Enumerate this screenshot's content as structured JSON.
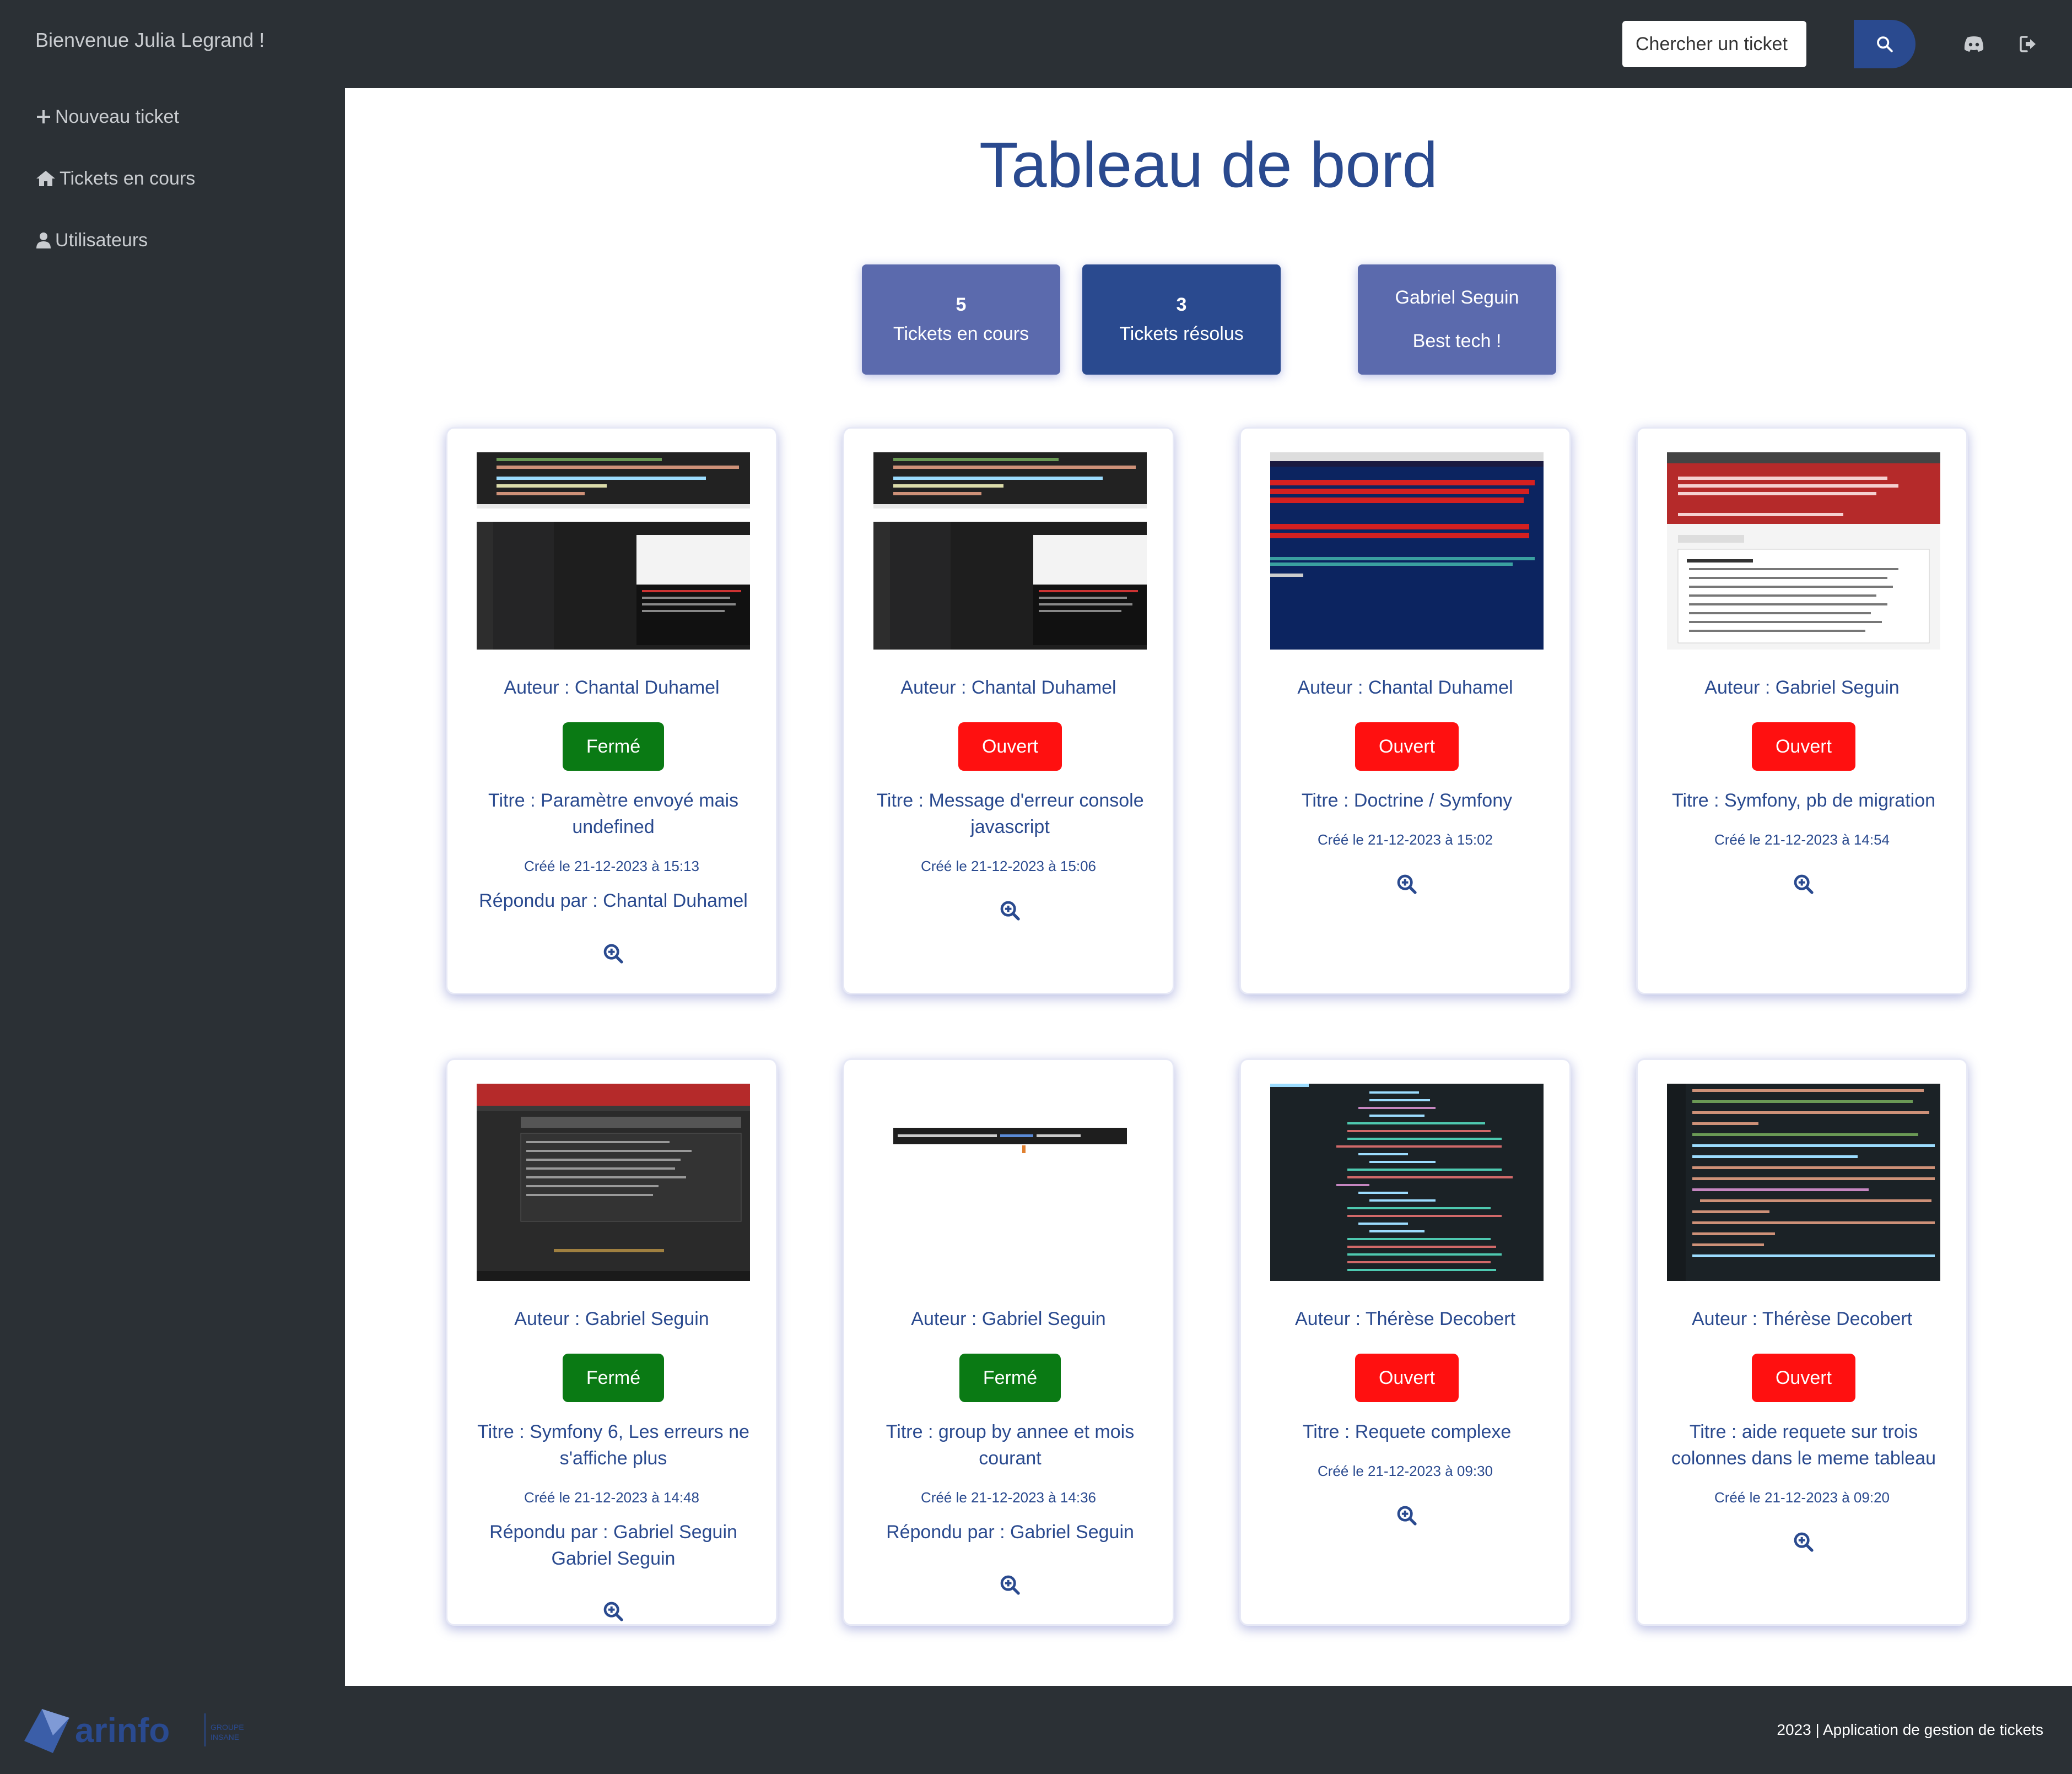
{
  "header": {
    "welcome": "Bienvenue Julia Legrand !",
    "search_placeholder": "Chercher un ticket"
  },
  "icons": {
    "search": "search-icon",
    "discord": "discord-icon",
    "logout": "logout-icon"
  },
  "sidebar": {
    "items": [
      {
        "label": "Nouveau ticket",
        "icon": "plus-icon"
      },
      {
        "label": "Tickets en cours",
        "icon": "home-icon"
      },
      {
        "label": "Utilisateurs",
        "icon": "user-icon"
      }
    ]
  },
  "main": {
    "title": "Tableau de bord",
    "stats": [
      {
        "value": "5",
        "label": "Tickets en cours"
      },
      {
        "value": "3",
        "label": "Tickets résolus"
      },
      {
        "value": "Gabriel Seguin",
        "label": "Best tech !"
      }
    ],
    "tickets": [
      {
        "author": "Auteur : Chantal Duhamel",
        "status": "Fermé",
        "title": "Titre : Paramètre envoyé mais undefined",
        "date": "Créé le 21-12-2023 à 15:13",
        "reply": "Répondu par : Chantal Duhamel"
      },
      {
        "author": "Auteur : Chantal Duhamel",
        "status": "Ouvert",
        "title": "Titre : Message d'erreur console javascript",
        "date": "Créé le 21-12-2023 à 15:06"
      },
      {
        "author": "Auteur : Chantal Duhamel",
        "status": "Ouvert",
        "title": "Titre : Doctrine / Symfony",
        "date": "Créé le 21-12-2023 à 15:02"
      },
      {
        "author": "Auteur : Gabriel Seguin",
        "status": "Ouvert",
        "title": "Titre : Symfony, pb de migration",
        "date": "Créé le 21-12-2023 à 14:54"
      },
      {
        "author": "Auteur : Gabriel Seguin",
        "status": "Fermé",
        "title": "Titre : Symfony 6, Les erreurs ne s'affiche plus",
        "date": "Créé le 21-12-2023 à 14:48",
        "reply": "Répondu par : Gabriel Seguin Gabriel Seguin"
      },
      {
        "author": "Auteur : Gabriel Seguin",
        "status": "Fermé",
        "title": "Titre : group by annee et mois courant",
        "date": "Créé le 21-12-2023 à 14:36",
        "reply": "Répondu par : Gabriel Seguin"
      },
      {
        "author": "Auteur : Thérèse Decobert",
        "status": "Ouvert",
        "title": "Titre : Requete complexe",
        "date": "Créé le 21-12-2023 à 09:30"
      },
      {
        "author": "Auteur : Thérèse Decobert",
        "status": "Ouvert",
        "title": "Titre : aide requete sur trois colonnes dans le meme tableau",
        "date": "Créé le 21-12-2023 à 09:20"
      }
    ]
  },
  "footer": {
    "text": "2023 | Application de gestion de tickets",
    "logo": "arinfo"
  },
  "colors": {
    "accent": "#2a4a8f",
    "sidebar": "#2b3035",
    "status_open": "#ff1010",
    "status_closed": "#0a7a14",
    "stat_light": "#5b6aad",
    "stat_dark": "#2a4a8f"
  }
}
